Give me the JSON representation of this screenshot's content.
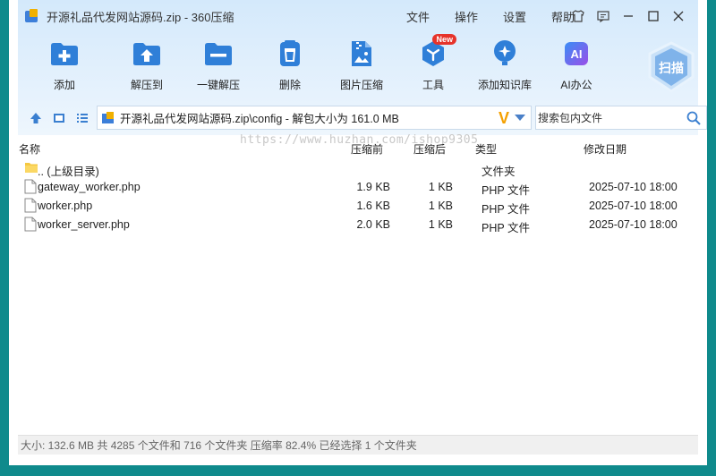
{
  "window": {
    "title": "开源礼品代发网站源码.zip - 360压缩",
    "menu": [
      "文件",
      "操作",
      "设置",
      "帮助"
    ]
  },
  "toolbar": {
    "items": [
      {
        "label": "添加",
        "icon": "add-icon"
      },
      {
        "label": "解压到",
        "icon": "extract-to-icon"
      },
      {
        "label": "一键解压",
        "icon": "one-click-extract-icon"
      },
      {
        "label": "删除",
        "icon": "delete-icon"
      },
      {
        "label": "图片压缩",
        "icon": "image-compress-icon"
      },
      {
        "label": "工具",
        "icon": "tools-icon",
        "badge": "New"
      },
      {
        "label": "添加知识库",
        "icon": "knowledge-base-icon"
      },
      {
        "label": "AI办公",
        "icon": "ai-office-icon",
        "icon_text": "AI"
      }
    ],
    "scan_label": "扫描"
  },
  "address": {
    "path": "开源礼品代发网站源码.zip\\config - 解包大小为 161.0 MB",
    "badge": "V"
  },
  "search": {
    "placeholder": "搜索包内文件"
  },
  "list": {
    "headers": {
      "name": "名称",
      "compressed_before": "压缩前",
      "compressed_after": "压缩后",
      "type": "类型",
      "modified": "修改日期"
    },
    "rows": [
      {
        "name": ".. (上级目录)",
        "before": "",
        "after": "",
        "type": "文件夹",
        "modified": "",
        "kind": "folder"
      },
      {
        "name": "gateway_worker.php",
        "before": "1.9 KB",
        "after": "1 KB",
        "type": "PHP 文件",
        "modified": "2025-07-10 18:00",
        "kind": "file"
      },
      {
        "name": "worker.php",
        "before": "1.6 KB",
        "after": "1 KB",
        "type": "PHP 文件",
        "modified": "2025-07-10 18:00",
        "kind": "file"
      },
      {
        "name": "worker_server.php",
        "before": "2.0 KB",
        "after": "1 KB",
        "type": "PHP 文件",
        "modified": "2025-07-10 18:00",
        "kind": "file"
      }
    ]
  },
  "watermark": "https://www.huzhan.com/ishop9305",
  "status": "大小: 132.6 MB 共 4285 个文件和 716 个文件夹 压缩率 82.4% 已经选择 1 个文件夹",
  "colors": {
    "accent": "#2f7fd8",
    "frame": "#0f8a8c",
    "toolbar_bg": "#d4e9fb"
  }
}
